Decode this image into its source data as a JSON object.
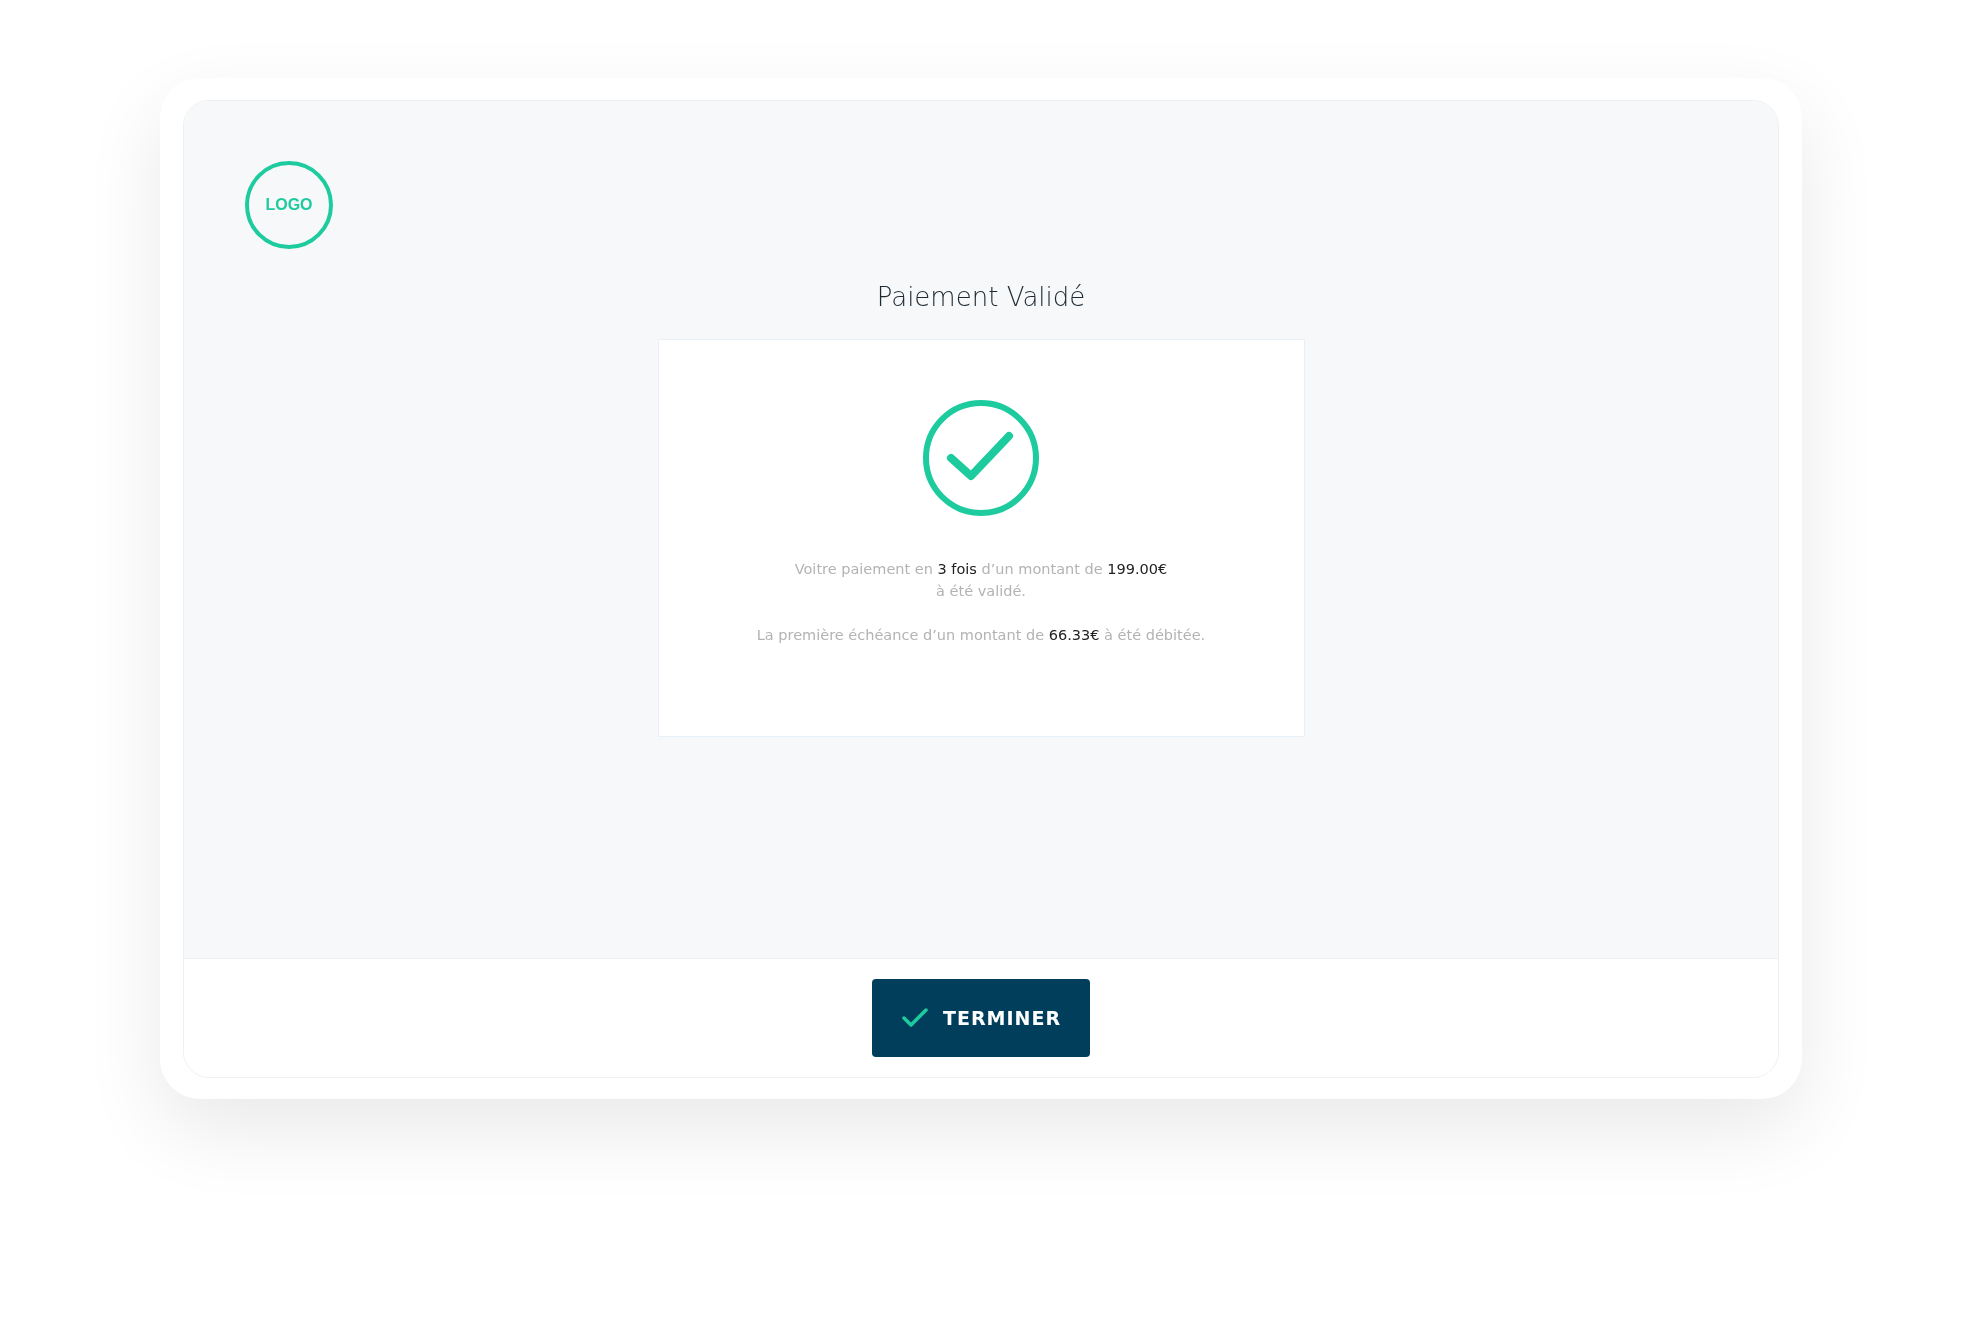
{
  "logo": {
    "text": "LOGO"
  },
  "title": "Paiement Validé",
  "card": {
    "paragraphs": [
      "Voitre paiement en **3 fois** d’un montant de **199.00€**\nà été validé.",
      "La première échéance d’un montant de **66.33€** à été débitée."
    ]
  },
  "button": {
    "label": "TERMINER"
  }
}
